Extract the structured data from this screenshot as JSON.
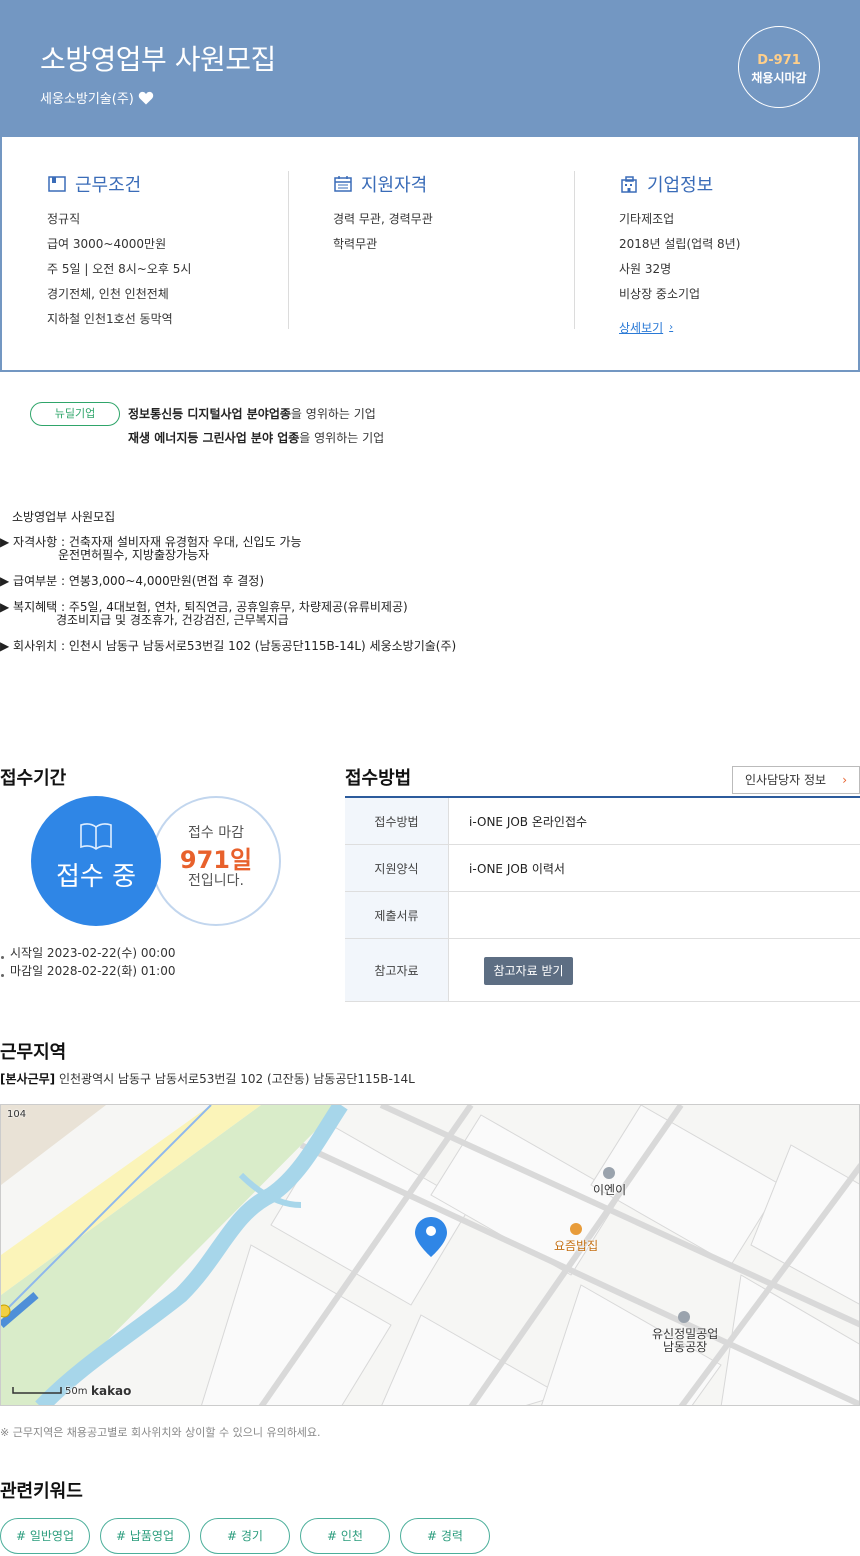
{
  "header": {
    "title": "소방영업부 사원모집",
    "company": "세웅소방기술(주)",
    "dday": "D-971",
    "close_type": "채용시마감",
    "colors": {
      "banner": "#7397c2",
      "dday": "#ffcf8a"
    }
  },
  "summary": {
    "conditions": {
      "title": "근무조건",
      "icon": "briefcase-icon",
      "lines": [
        "정규직",
        "급여 3000~4000만원",
        "주 5일 | 오전 8시~오후 5시",
        "경기전체, 인천 인천전체",
        "지하철 인천1호선 동막역"
      ]
    },
    "qualifications": {
      "title": "지원자격",
      "icon": "calendar-icon",
      "lines": [
        "경력 무관, 경력무관",
        "학력무관"
      ]
    },
    "company": {
      "title": "기업정보",
      "icon": "building-icon",
      "lines": [
        "기타제조업",
        "2018년 설립(업력 8년)",
        "사원 32명",
        "비상장 중소기업"
      ],
      "more": "상세보기"
    }
  },
  "newdeal": {
    "badge": "뉴딜기업",
    "line1_bold": "정보통신등 디지털사업 분야업종",
    "line1_rest": "을 영위하는 기업",
    "line2_bold": "재생 에너지등 그린사업 분야 업종",
    "line2_rest": "을 영위하는 기업"
  },
  "description": {
    "title": "소방영업부 사원모집",
    "items": [
      {
        "bullet": "▶",
        "text": " 자격사항 : 건축자재 설비자재 유경험자 우대, 신입도 가능",
        "cont": "운전면허필수, 지방출장가능자"
      },
      {
        "bullet": "▶",
        "text": " 급여부분 : 연봉3,000~4,000만원(면접 후 결정)",
        "cont": ""
      },
      {
        "bullet": "▶",
        "text": " 복지혜택 : 주5일, 4대보험, 연차, 퇴직연금, 공휴일휴무, 차량제공(유류비제공)",
        "cont": "경조비지급 및 경조휴가, 건강검진, 근무복지급"
      },
      {
        "bullet": "▶",
        "text": " 회사위치 : 인천시 남동구 남동서로53번길 102 (남동공단115B-14L) 세웅소방기술(주)",
        "cont": ""
      }
    ]
  },
  "period": {
    "title": "접수기간",
    "status": "접수 중",
    "deadline_label": "접수 마감",
    "days_left": "971일",
    "days_suffix": "전입니다.",
    "start": "시작일 2023-02-22(수) 00:00",
    "end": "마감일 2028-02-22(화) 01:00",
    "colors": {
      "status_circle": "#2f86e6",
      "days": "#e8612c"
    }
  },
  "method": {
    "title": "접수방법",
    "hr_button": "인사담당자 정보",
    "rows": [
      {
        "label": "접수방법",
        "value": "i-ONE JOB 온라인접수"
      },
      {
        "label": "지원양식",
        "value": "i-ONE JOB 이력서"
      },
      {
        "label": "제출서류",
        "value": ""
      },
      {
        "label": "참고자료",
        "value": ""
      }
    ],
    "ref_button": "참고자료 받기"
  },
  "region": {
    "title": "근무지역",
    "tag": "[본사근무]",
    "address": " 인천광역시 남동구 남동서로53번길 102 (고잔동) 남동공단115B-14L",
    "map": {
      "road_number": "104",
      "places": [
        "이엔이",
        "요즘밥집",
        "유신정밀공업",
        "남동공장"
      ],
      "scale": "50m",
      "provider": "kakao"
    },
    "notice": "※ 근무지역은 채용공고별로 회사위치와 상이할 수 있으니 유의하세요."
  },
  "keywords": {
    "title": "관련키워드",
    "items": [
      "# 일반영업",
      "# 납품영업",
      "# 경기",
      "# 인천",
      "# 경력"
    ]
  }
}
